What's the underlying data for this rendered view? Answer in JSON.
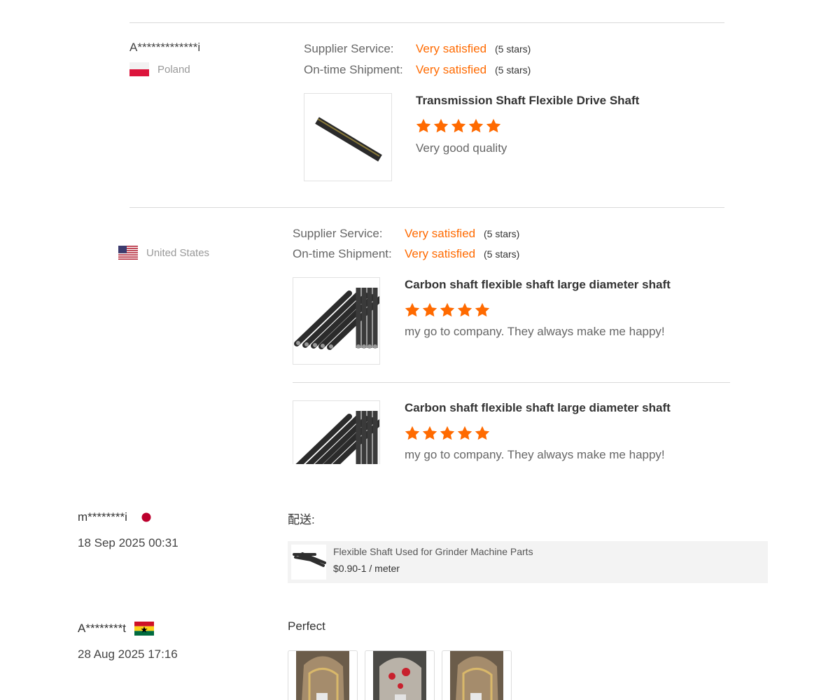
{
  "review_card_1": {
    "reviewer": "A*************i",
    "country": "Poland",
    "flag_icon": "poland-flag-icon",
    "ratings": [
      {
        "label": "Supplier Service:",
        "value": "Very satisfied",
        "stars_note": "(5 stars)"
      },
      {
        "label": "On-time Shipment:",
        "value": "Very satisfied",
        "stars_note": "(5 stars)"
      }
    ],
    "product": {
      "title": "Transmission Shaft Flexible Drive Shaft",
      "rating": 5,
      "comment": "Very good quality"
    }
  },
  "review_card_2": {
    "country": "United States",
    "flag_icon": "usa-flag-icon",
    "ratings": [
      {
        "label": "Supplier Service:",
        "value": "Very satisfied",
        "stars_note": "(5 stars)"
      },
      {
        "label": "On-time Shipment:",
        "value": "Very satisfied",
        "stars_note": "(5 stars)"
      }
    ],
    "products": [
      {
        "title": "Carbon shaft flexible shaft large diameter shaft",
        "rating": 5,
        "comment": "my go to company. They always make me happy!"
      },
      {
        "title": "Carbon shaft flexible shaft large diameter shaft",
        "rating": 5,
        "comment": "my go to company. They always make me happy!"
      }
    ]
  },
  "reviews_list": [
    {
      "reviewer": "m********i",
      "flag_icon": "japan-flag-icon",
      "date": "18 Sep 2025 00:31",
      "section_label": "配送:",
      "product": {
        "title": "Flexible Shaft Used for Grinder Machine Parts",
        "price": "$0.90-1 / meter"
      }
    },
    {
      "reviewer": "A********t",
      "flag_icon": "ghana-flag-icon",
      "date": "28 Aug 2025 17:16",
      "comment": "Perfect",
      "photos": [
        "review-photo-1",
        "review-photo-2",
        "review-photo-3"
      ]
    }
  ],
  "colors": {
    "accent": "#ff6a00",
    "star": "#ff6a00",
    "divider": "#d9d9d9"
  }
}
